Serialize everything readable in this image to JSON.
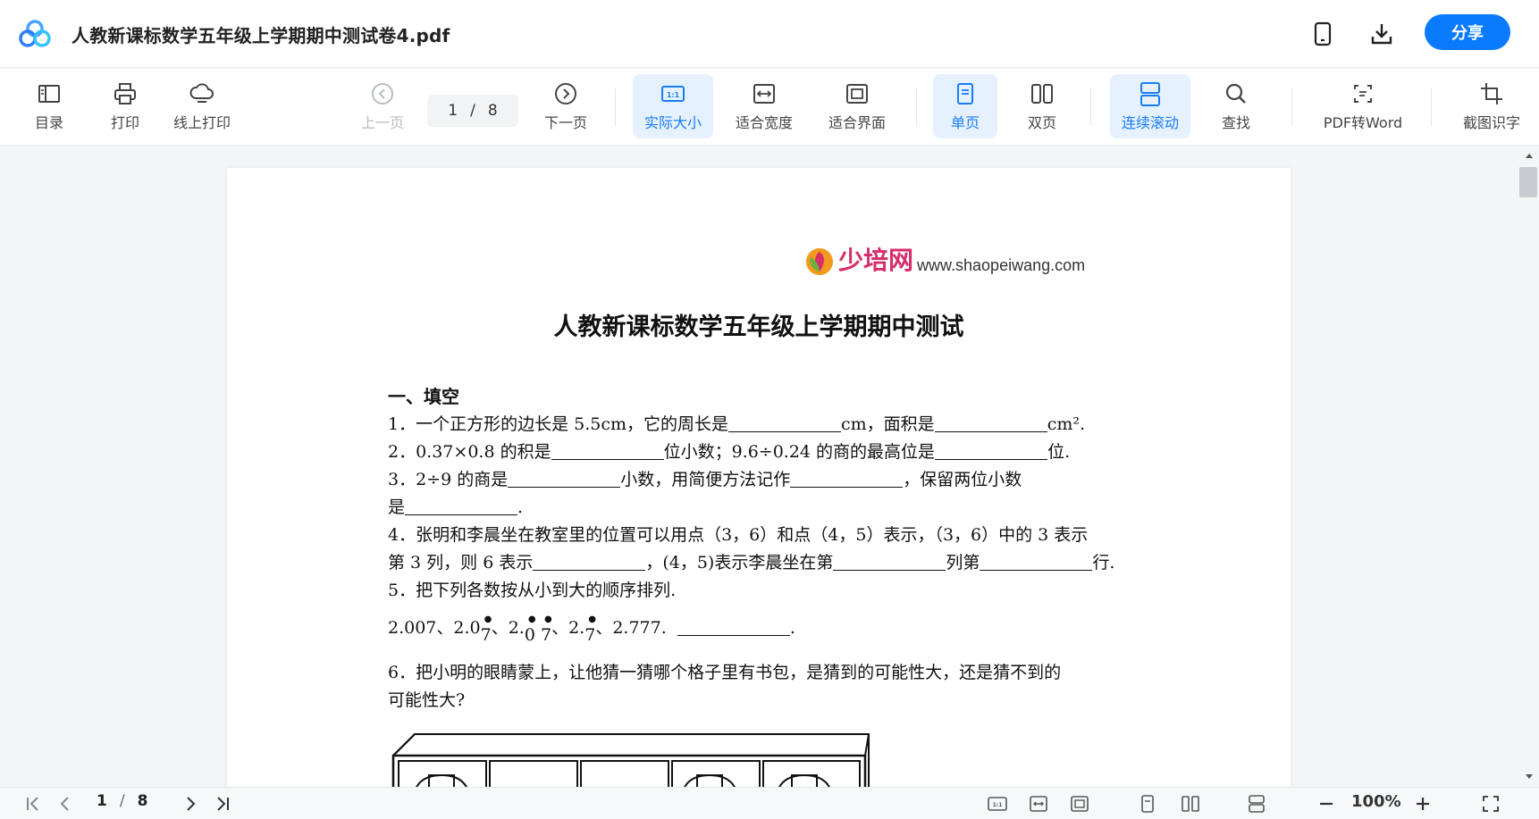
{
  "window": {
    "title": "人教新课标数学五年级上学期期中测试卷4.pdf",
    "share_label": "分享"
  },
  "toolbar": {
    "toc": "目录",
    "print": "打印",
    "online_print": "线上打印",
    "prev_page": "上一页",
    "current_page": "1",
    "separator": "/",
    "total_pages": "8",
    "next_page": "下一页",
    "actual_size": "实际大小",
    "fit_width": "适合宽度",
    "fit_page": "适合界面",
    "single_page": "单页",
    "double_page": "双页",
    "continuous_scroll": "连续滚动",
    "find": "查找",
    "pdf_to_word": "PDF转Word",
    "screenshot_ocr": "截图识字"
  },
  "document": {
    "brand_cn": "少培网",
    "brand_url": "www.shaopeiwang.com",
    "title": "人教新课标数学五年级上学期期中测试",
    "section1": "一、填空",
    "q1": {
      "a": "1．一个正方形的边长是 5.5cm，它的周长是",
      "b": "cm，面积是",
      "c": "cm²."
    },
    "q2": {
      "a": "2．0.37×0.8 的积是",
      "b": "位小数；9.6÷0.24 的商的最高位是",
      "c": "位."
    },
    "q3": {
      "a": "3．2÷9 的商是",
      "b": "小数，用简便方法记作",
      "c": "，保留两位小数"
    },
    "q3b": {
      "a": "是",
      "b": "."
    },
    "q4": "4．张明和李晨坐在教室里的位置可以用点（3，6）和点（4，5）表示，（3，6）中的 3 表示",
    "q4b": {
      "a": "第 3 列，则 6 表示",
      "b": "，(4，5)表示李晨坐在第",
      "c": "列第",
      "d": "行."
    },
    "q5": "5．把下列各数按从小到大的顺序排列.",
    "q5b": {
      "a": "2.007、2.0",
      "b": "7",
      "c": "、2.",
      "d": "0",
      "e": "7",
      "f": "、2.",
      "g": "7",
      "h": "、2.777.",
      "i": "."
    },
    "q6": "6．把小明的眼睛蒙上，让他猜一猜哪个格子里有书包，是猜到的可能性大，还是猜不到的",
    "q6b": "可能性大?"
  },
  "statusbar": {
    "current_page": "1",
    "separator": "/",
    "total_pages": "8",
    "zoom": "100%"
  },
  "colors": {
    "accent": "#1a7cf5",
    "share": "#0a7bff",
    "brand": "#d72e6a"
  }
}
